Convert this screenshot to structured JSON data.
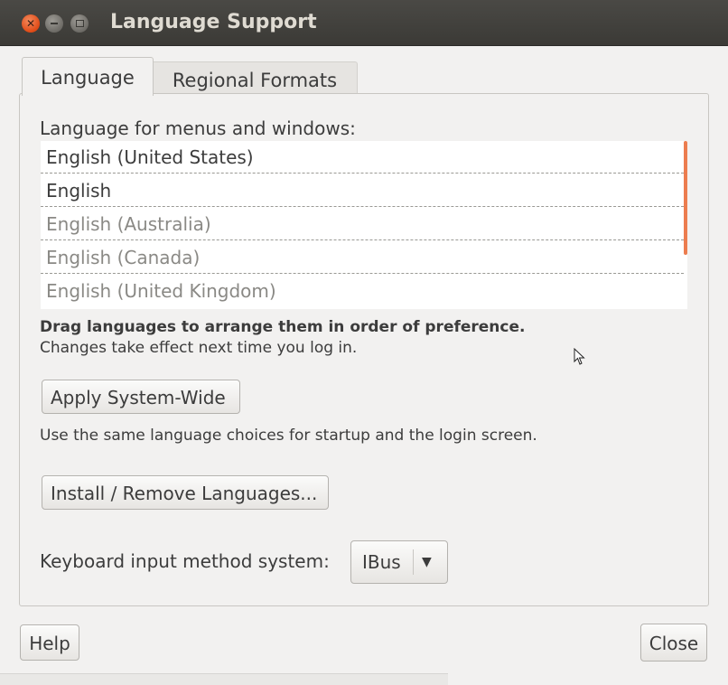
{
  "window": {
    "title": "Language Support",
    "accent_color": "#df4a16"
  },
  "tabs": [
    {
      "label": "Language",
      "active": true
    },
    {
      "label": "Regional Formats",
      "active": false
    }
  ],
  "language_section": {
    "label": "Language for menus and windows:",
    "languages": [
      {
        "label": "English (United States)",
        "state": "active"
      },
      {
        "label": "English",
        "state": "active"
      },
      {
        "label": "English (Australia)",
        "state": "inactive"
      },
      {
        "label": "English (Canada)",
        "state": "inactive"
      },
      {
        "label": "English (United Kingdom)",
        "state": "inactive"
      }
    ],
    "hint_bold": "Drag languages to arrange them in order of preference.",
    "hint": "Changes take effect next time you log in."
  },
  "apply": {
    "button_label": "Apply System-Wide",
    "description": "Use the same language choices for startup and the login screen."
  },
  "install": {
    "button_label": "Install / Remove Languages..."
  },
  "keyboard": {
    "label": "Keyboard input method system:",
    "selected": "IBus",
    "dropdown_icon": "chevron-down-icon"
  },
  "footer": {
    "help_label": "Help",
    "close_label": "Close"
  }
}
